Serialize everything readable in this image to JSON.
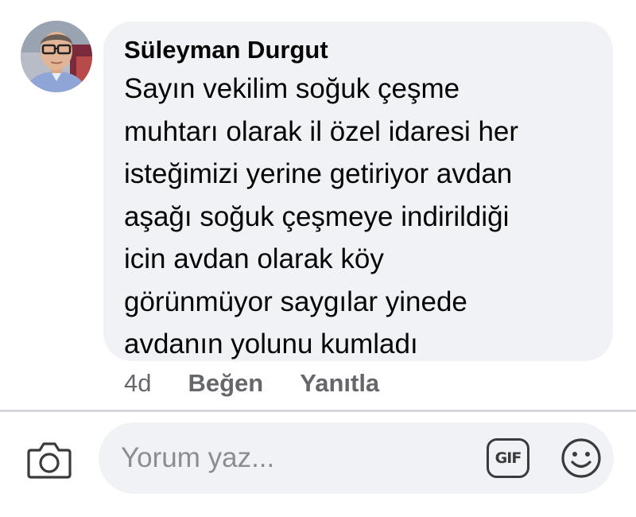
{
  "comment": {
    "author": "Süleyman Durgut",
    "text": "Sayın vekilim soğuk çeşme\nmuhtarı olarak il özel idaresi her\nisteğimizi yerine getiriyor avdan\naşağı soğuk çeşmeye indirildiği\nicin avdan olarak köy\ngörünmüyor saygılar yinede\navdanın yolunu kumladı",
    "time": "4d",
    "like_label": "Beğen",
    "reply_label": "Yanıtla"
  },
  "composer": {
    "placeholder": "Yorum yaz...",
    "gif_label": "GIF",
    "camera_icon": "camera-icon",
    "emoji_icon": "smiley-icon"
  },
  "colors": {
    "bubble": "#f0f2f5",
    "meta_text": "#65676b",
    "placeholder_text": "#8a8d91",
    "icon": "#3a3b3c"
  }
}
